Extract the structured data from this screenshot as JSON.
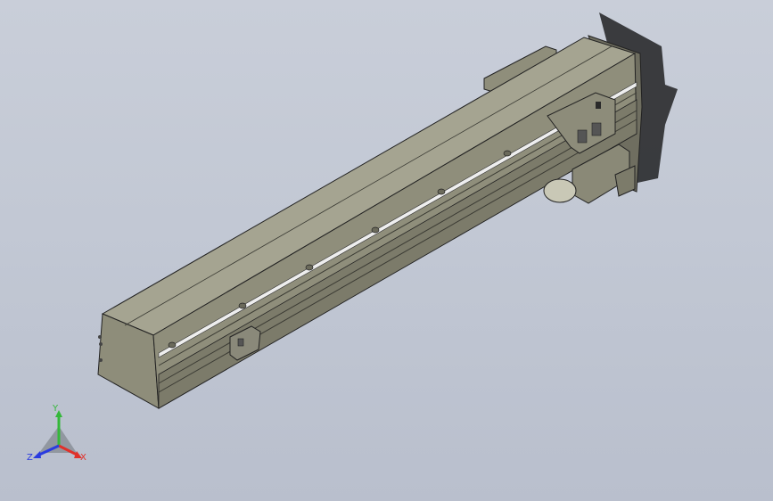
{
  "viewport": {
    "background_top": "#c9ced9",
    "background_bottom": "#b9bfcd"
  },
  "model": {
    "body_color": "#9b9a86",
    "body_dark": "#7e7d6c",
    "body_light": "#b2b19f",
    "rail_color": "#eeeeee",
    "edge_color": "#2a2a26"
  },
  "triad": {
    "x_label": "X",
    "y_label": "Y",
    "z_label": "Z",
    "x_color": "#e0302a",
    "y_color": "#34b83a",
    "z_color": "#2a3be0"
  }
}
